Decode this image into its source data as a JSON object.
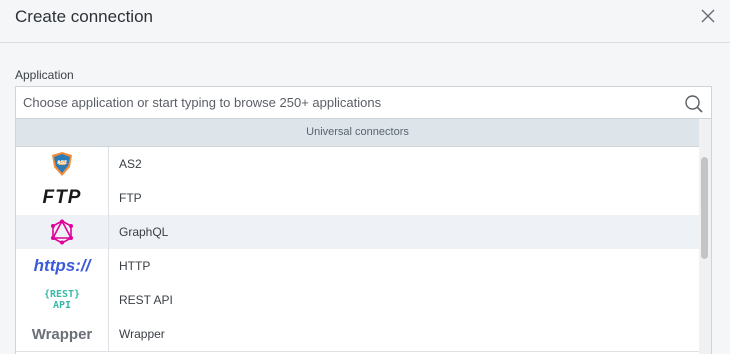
{
  "dialog": {
    "title": "Create connection"
  },
  "application_field": {
    "label": "Application",
    "placeholder": "Choose application or start typing to browse 250+ applications"
  },
  "list": {
    "group_header": "Universal connectors",
    "items": [
      {
        "name": "AS2",
        "logo_text": "AS2"
      },
      {
        "name": "FTP",
        "logo_text": "FTP"
      },
      {
        "name": "GraphQL",
        "logo_text": ""
      },
      {
        "name": "HTTP",
        "logo_text": "https://"
      },
      {
        "name": "REST API",
        "logo_text_line1": "{REST}",
        "logo_text_line2": "API"
      },
      {
        "name": "Wrapper",
        "logo_text": "Wrapper"
      }
    ],
    "selected_index": 2
  },
  "colors": {
    "graphql": "#e10098",
    "https": "#3b5bdb",
    "rest": "#3ab9a8",
    "selected_row": "#eef2f6",
    "group_header_bg": "#dde4ea"
  }
}
